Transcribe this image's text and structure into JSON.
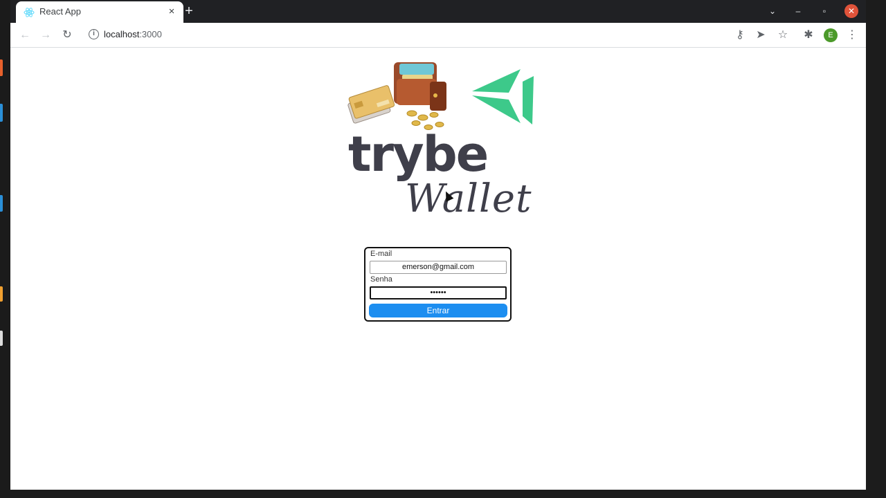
{
  "browser": {
    "tab": {
      "title": "React App",
      "close_glyph": "×",
      "favicon": "react-icon"
    },
    "new_tab_glyph": "+",
    "window_controls": {
      "tab_search": "⌄",
      "minimize": "–",
      "restore": "▫",
      "close": "✕"
    },
    "toolbar": {
      "back": "←",
      "forward": "→",
      "reload": "↻",
      "url_host": "localhost",
      "url_port": ":3000",
      "info_glyph": "i",
      "password_glyph": "⚷",
      "send_glyph": "➤",
      "star_glyph": "☆",
      "extensions_glyph": "✱",
      "avatar_letter": "E",
      "menu_glyph": "⋮"
    }
  },
  "logo": {
    "line1": "trybe",
    "line2": "Wallet"
  },
  "login": {
    "email_label": "E-mail",
    "email_value": "emerson@gmail.com",
    "password_label": "Senha",
    "password_value": "••••••",
    "submit_label": "Entrar"
  },
  "colors": {
    "accent": "#1d8ef0",
    "brand_green": "#3dc98a",
    "avatar": "#4c9a2a",
    "close": "#e0533a"
  }
}
